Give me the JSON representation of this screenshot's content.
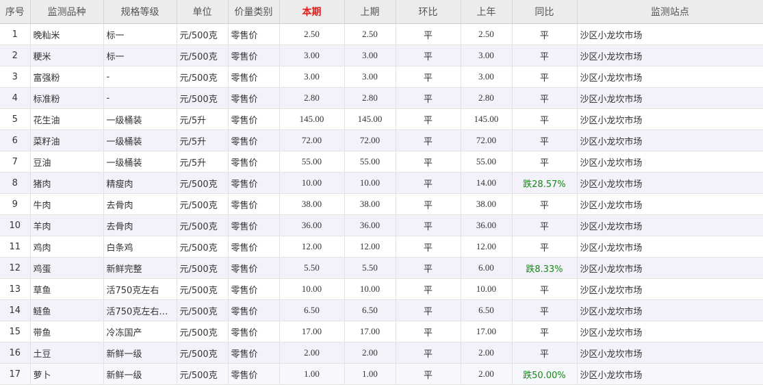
{
  "table": {
    "headers": {
      "index": "序号",
      "name": "监测品种",
      "spec": "规格等级",
      "unit": "单位",
      "price_type": "价量类别",
      "current": "本期",
      "previous": "上期",
      "mom": "环比",
      "last_year": "上年",
      "yoy": "同比",
      "station": "监测站点"
    },
    "rows": [
      {
        "index": "1",
        "name": "晚籼米",
        "spec": "标一",
        "unit": "元/500克",
        "price_type": "零售价",
        "current": "2.50",
        "previous": "2.50",
        "mom": "平",
        "last_year": "2.50",
        "yoy": "平",
        "station": "沙区小龙坎市场"
      },
      {
        "index": "2",
        "name": "粳米",
        "spec": "标一",
        "unit": "元/500克",
        "price_type": "零售价",
        "current": "3.00",
        "previous": "3.00",
        "mom": "平",
        "last_year": "3.00",
        "yoy": "平",
        "station": "沙区小龙坎市场"
      },
      {
        "index": "3",
        "name": "富强粉",
        "spec": "-",
        "unit": "元/500克",
        "price_type": "零售价",
        "current": "3.00",
        "previous": "3.00",
        "mom": "平",
        "last_year": "3.00",
        "yoy": "平",
        "station": "沙区小龙坎市场"
      },
      {
        "index": "4",
        "name": "标准粉",
        "spec": "-",
        "unit": "元/500克",
        "price_type": "零售价",
        "current": "2.80",
        "previous": "2.80",
        "mom": "平",
        "last_year": "2.80",
        "yoy": "平",
        "station": "沙区小龙坎市场"
      },
      {
        "index": "5",
        "name": "花生油",
        "spec": "一级桶装",
        "unit": "元/5升",
        "price_type": "零售价",
        "current": "145.00",
        "previous": "145.00",
        "mom": "平",
        "last_year": "145.00",
        "yoy": "平",
        "station": "沙区小龙坎市场"
      },
      {
        "index": "6",
        "name": "菜籽油",
        "spec": "一级桶装",
        "unit": "元/5升",
        "price_type": "零售价",
        "current": "72.00",
        "previous": "72.00",
        "mom": "平",
        "last_year": "72.00",
        "yoy": "平",
        "station": "沙区小龙坎市场"
      },
      {
        "index": "7",
        "name": "豆油",
        "spec": "一级桶装",
        "unit": "元/5升",
        "price_type": "零售价",
        "current": "55.00",
        "previous": "55.00",
        "mom": "平",
        "last_year": "55.00",
        "yoy": "平",
        "station": "沙区小龙坎市场"
      },
      {
        "index": "8",
        "name": "猪肉",
        "spec": "精瘦肉",
        "unit": "元/500克",
        "price_type": "零售价",
        "current": "10.00",
        "previous": "10.00",
        "mom": "平",
        "last_year": "14.00",
        "yoy": "跌28.57%",
        "yoy_trend": "down",
        "station": "沙区小龙坎市场"
      },
      {
        "index": "9",
        "name": "牛肉",
        "spec": "去骨肉",
        "unit": "元/500克",
        "price_type": "零售价",
        "current": "38.00",
        "previous": "38.00",
        "mom": "平",
        "last_year": "38.00",
        "yoy": "平",
        "station": "沙区小龙坎市场"
      },
      {
        "index": "10",
        "name": "羊肉",
        "spec": "去骨肉",
        "unit": "元/500克",
        "price_type": "零售价",
        "current": "36.00",
        "previous": "36.00",
        "mom": "平",
        "last_year": "36.00",
        "yoy": "平",
        "station": "沙区小龙坎市场"
      },
      {
        "index": "11",
        "name": "鸡肉",
        "spec": "白条鸡",
        "unit": "元/500克",
        "price_type": "零售价",
        "current": "12.00",
        "previous": "12.00",
        "mom": "平",
        "last_year": "12.00",
        "yoy": "平",
        "station": "沙区小龙坎市场"
      },
      {
        "index": "12",
        "name": "鸡蛋",
        "spec": "新鲜完整",
        "unit": "元/500克",
        "price_type": "零售价",
        "current": "5.50",
        "previous": "5.50",
        "mom": "平",
        "last_year": "6.00",
        "yoy": "跌8.33%",
        "yoy_trend": "down",
        "station": "沙区小龙坎市场"
      },
      {
        "index": "13",
        "name": "草鱼",
        "spec": "活750克左右",
        "unit": "元/500克",
        "price_type": "零售价",
        "current": "10.00",
        "previous": "10.00",
        "mom": "平",
        "last_year": "10.00",
        "yoy": "平",
        "station": "沙区小龙坎市场"
      },
      {
        "index": "14",
        "name": "鲢鱼",
        "spec": "活750克左右…",
        "unit": "元/500克",
        "price_type": "零售价",
        "current": "6.50",
        "previous": "6.50",
        "mom": "平",
        "last_year": "6.50",
        "yoy": "平",
        "station": "沙区小龙坎市场"
      },
      {
        "index": "15",
        "name": "带鱼",
        "spec": "冷冻国产",
        "unit": "元/500克",
        "price_type": "零售价",
        "current": "17.00",
        "previous": "17.00",
        "mom": "平",
        "last_year": "17.00",
        "yoy": "平",
        "station": "沙区小龙坎市场"
      },
      {
        "index": "16",
        "name": "土豆",
        "spec": "新鲜一级",
        "unit": "元/500克",
        "price_type": "零售价",
        "current": "2.00",
        "previous": "2.00",
        "mom": "平",
        "last_year": "2.00",
        "yoy": "平",
        "station": "沙区小龙坎市场"
      },
      {
        "index": "17",
        "name": "萝卜",
        "spec": "新鲜一级",
        "unit": "元/500克",
        "price_type": "零售价",
        "current": "1.00",
        "previous": "1.00",
        "mom": "平",
        "last_year": "2.00",
        "yoy": "跌50.00%",
        "yoy_trend": "down",
        "station": "沙区小龙坎市场"
      }
    ]
  },
  "colors": {
    "header_bg": "#ececec",
    "current_header": "#e21f1f",
    "row_stripe": "#f3f2fa",
    "decline_text": "#138a13"
  }
}
